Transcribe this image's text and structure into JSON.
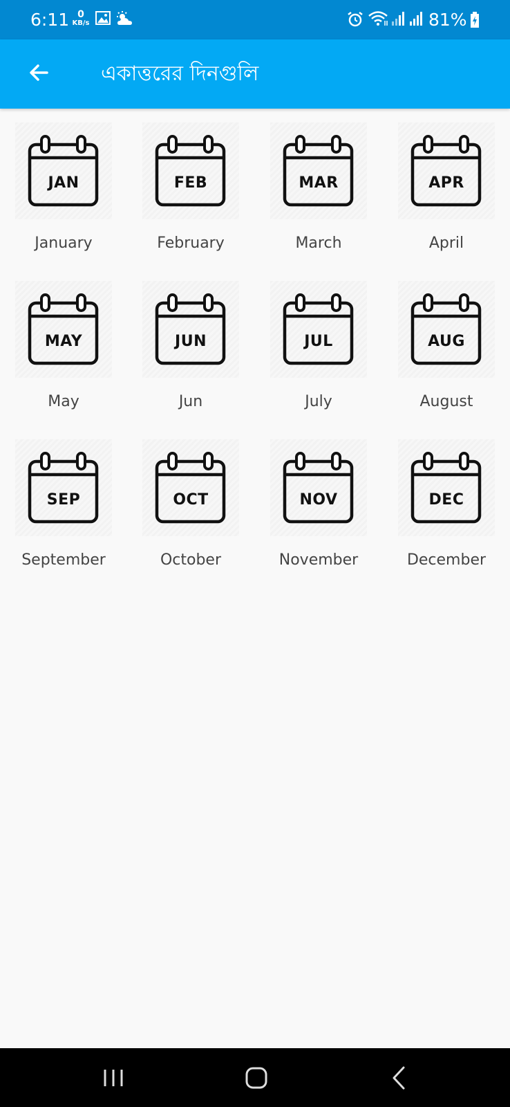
{
  "status_bar": {
    "time": "6:11",
    "speed_value": "0",
    "speed_unit": "KB/s",
    "battery": "81%",
    "icons": [
      "gallery-icon",
      "weather-icon",
      "alarm-icon",
      "wifi-icon",
      "signal-icon",
      "signal-icon",
      "battery-charging-icon"
    ]
  },
  "app_bar": {
    "title": "একাত্তরের দিনগুলি",
    "back_icon": "arrow-left-icon",
    "color": "#03a9f4"
  },
  "months": [
    {
      "abbr": "JAN",
      "label": "January"
    },
    {
      "abbr": "FEB",
      "label": "February"
    },
    {
      "abbr": "MAR",
      "label": "March"
    },
    {
      "abbr": "APR",
      "label": "April"
    },
    {
      "abbr": "MAY",
      "label": "May"
    },
    {
      "abbr": "JUN",
      "label": "Jun"
    },
    {
      "abbr": "JUL",
      "label": "July"
    },
    {
      "abbr": "AUG",
      "label": "August"
    },
    {
      "abbr": "SEP",
      "label": "September"
    },
    {
      "abbr": "OCT",
      "label": "October"
    },
    {
      "abbr": "NOV",
      "label": "November"
    },
    {
      "abbr": "DEC",
      "label": "December"
    }
  ],
  "nav_bar": {
    "icons": [
      "recent-apps-icon",
      "home-icon",
      "back-icon"
    ]
  }
}
